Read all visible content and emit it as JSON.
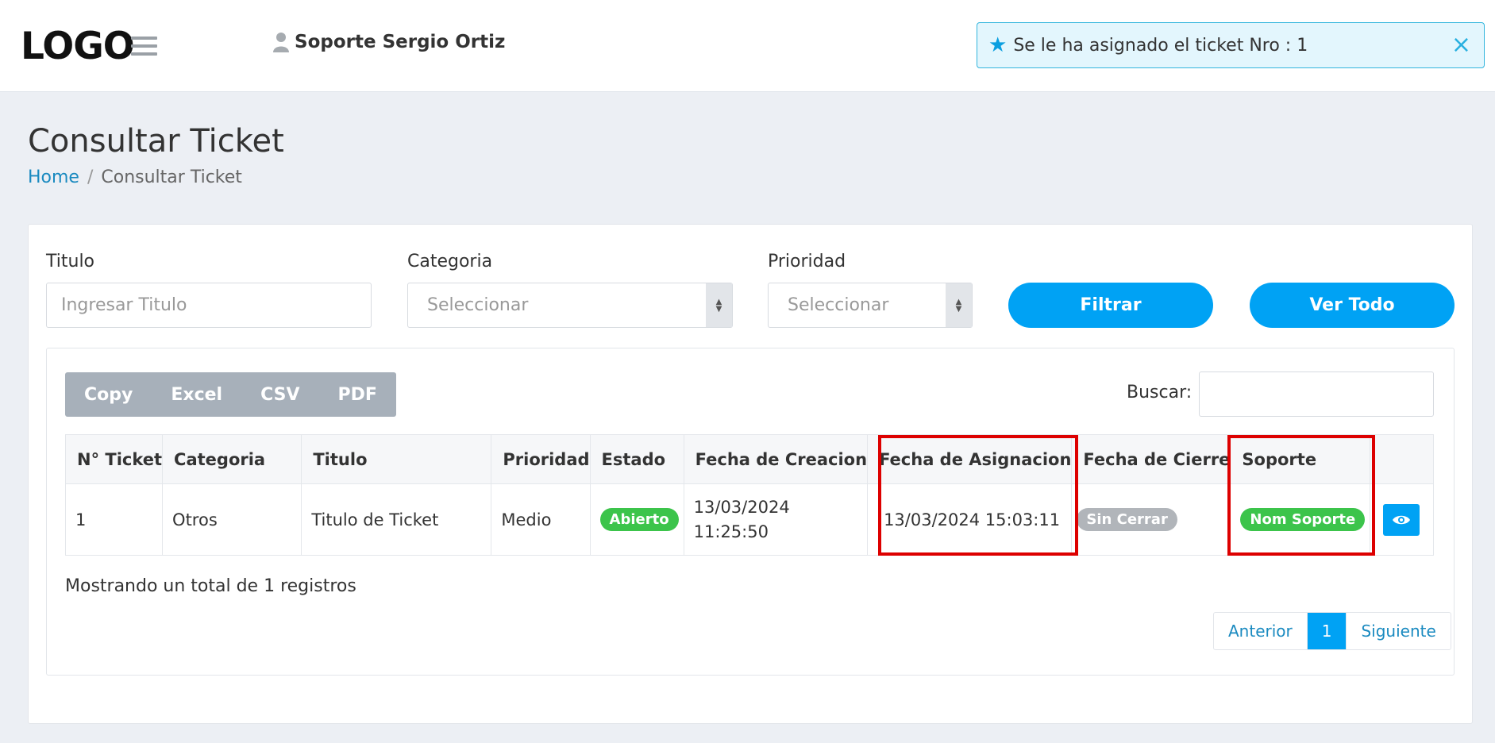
{
  "header": {
    "logo": "LOGO",
    "user_name": "Soporte Sergio Ortiz",
    "notification": "Se le ha asignado el ticket Nro : 1",
    "notification_close": "×"
  },
  "page": {
    "title": "Consultar Ticket",
    "breadcrumb": {
      "home": "Home",
      "separator": "/",
      "current": "Consultar Ticket"
    }
  },
  "filters": {
    "titulo_label": "Titulo",
    "titulo_placeholder": "Ingresar Titulo",
    "categoria_label": "Categoria",
    "categoria_value": "Seleccionar",
    "prioridad_label": "Prioridad",
    "prioridad_value": "Seleccionar",
    "filtrar": "Filtrar",
    "ver_todo": "Ver Todo"
  },
  "table_tools": {
    "export_buttons": [
      "Copy",
      "Excel",
      "CSV",
      "PDF"
    ],
    "search_label": "Buscar:"
  },
  "table": {
    "headers": [
      "N° Ticket",
      "Categoria",
      "Titulo",
      "Prioridad",
      "Estado",
      "Fecha de Creacion",
      "Fecha de Asignacion",
      "Fecha de Cierre",
      "Soporte"
    ],
    "rows": [
      {
        "ticket": "1",
        "categoria": "Otros",
        "titulo": "Titulo de Ticket",
        "prioridad": "Medio",
        "estado": "Abierto",
        "fecha_creacion_date": "13/03/2024",
        "fecha_creacion_time": "11:25:50",
        "fecha_asignacion": "13/03/2024 15:03:11",
        "fecha_cierre": "Sin Cerrar",
        "soporte": "Nom Soporte"
      }
    ]
  },
  "footer": {
    "total": "Mostrando un total de 1 registros",
    "pager": {
      "prev": "Anterior",
      "page": "1",
      "next": "Siguiente"
    }
  },
  "colors": {
    "primary": "#00a2f4",
    "success": "#3cc44b",
    "muted": "#b1b5ba",
    "highlight": "#dd0000"
  }
}
